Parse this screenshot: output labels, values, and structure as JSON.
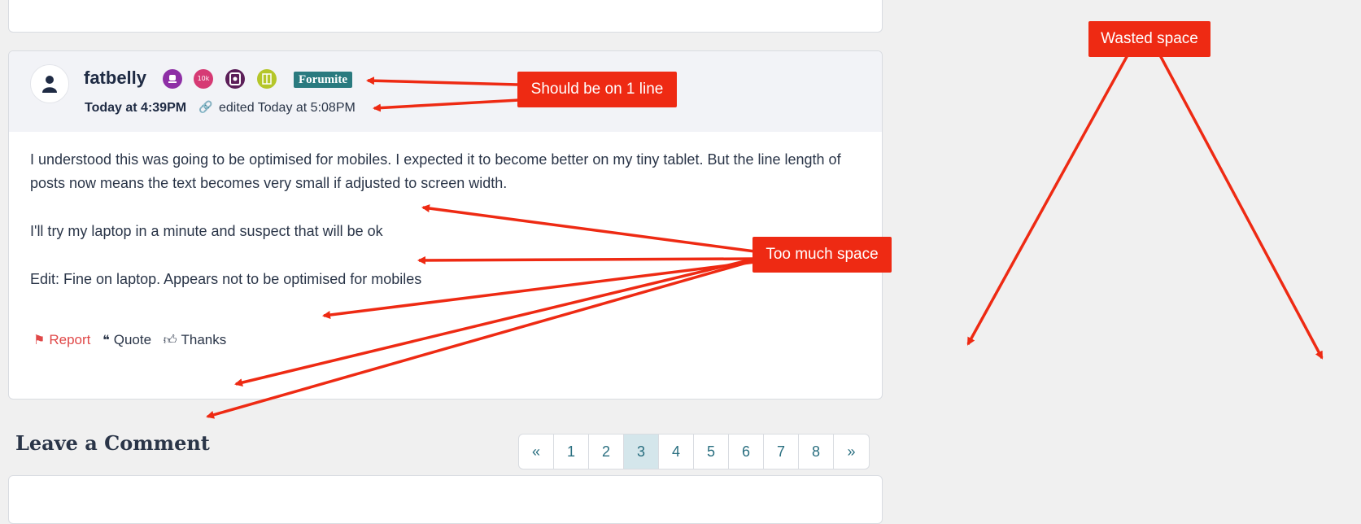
{
  "post": {
    "username": "fatbelly",
    "rank": "Forumite",
    "badges": [
      {
        "name": "trophy-badge",
        "text": "",
        "color": "#8e2fa6"
      },
      {
        "name": "10k-badge",
        "text": "10k",
        "color": "#d63a74"
      },
      {
        "name": "tablet-badge",
        "text": "",
        "color": "#5c1f59"
      },
      {
        "name": "book-badge",
        "text": "",
        "color": "#b5c62a"
      }
    ],
    "timestamp": "Today at 4:39PM",
    "edited": "edited Today at 5:08PM",
    "paragraphs": [
      "I understood this was going to be optimised for mobiles. I expected it to become better on my tiny tablet. But the line length of posts now means the text becomes very small if adjusted to screen width.",
      "I'll try my laptop in a minute and suspect that will be ok",
      "Edit: Fine on laptop. Appears not to be optimised for mobiles"
    ],
    "actions": {
      "report": "Report",
      "quote": "Quote",
      "thanks": "Thanks"
    }
  },
  "comment": {
    "heading": "Leave a Comment"
  },
  "pagination": {
    "prev": "«",
    "pages": [
      "1",
      "2",
      "3",
      "4",
      "5",
      "6",
      "7",
      "8"
    ],
    "current": "3",
    "next": "»"
  },
  "annotations": {
    "wasted_space": "Wasted space",
    "one_line": "Should be on 1 line",
    "too_much_space": "Too much space",
    "color": "#ee2a13"
  },
  "colors": {
    "page_bg": "#f0f0f0",
    "header_bg": "#f2f3f7",
    "rank_bg": "#2a7a7f",
    "report": "#e04848",
    "active_page": "#d4e6eb"
  }
}
